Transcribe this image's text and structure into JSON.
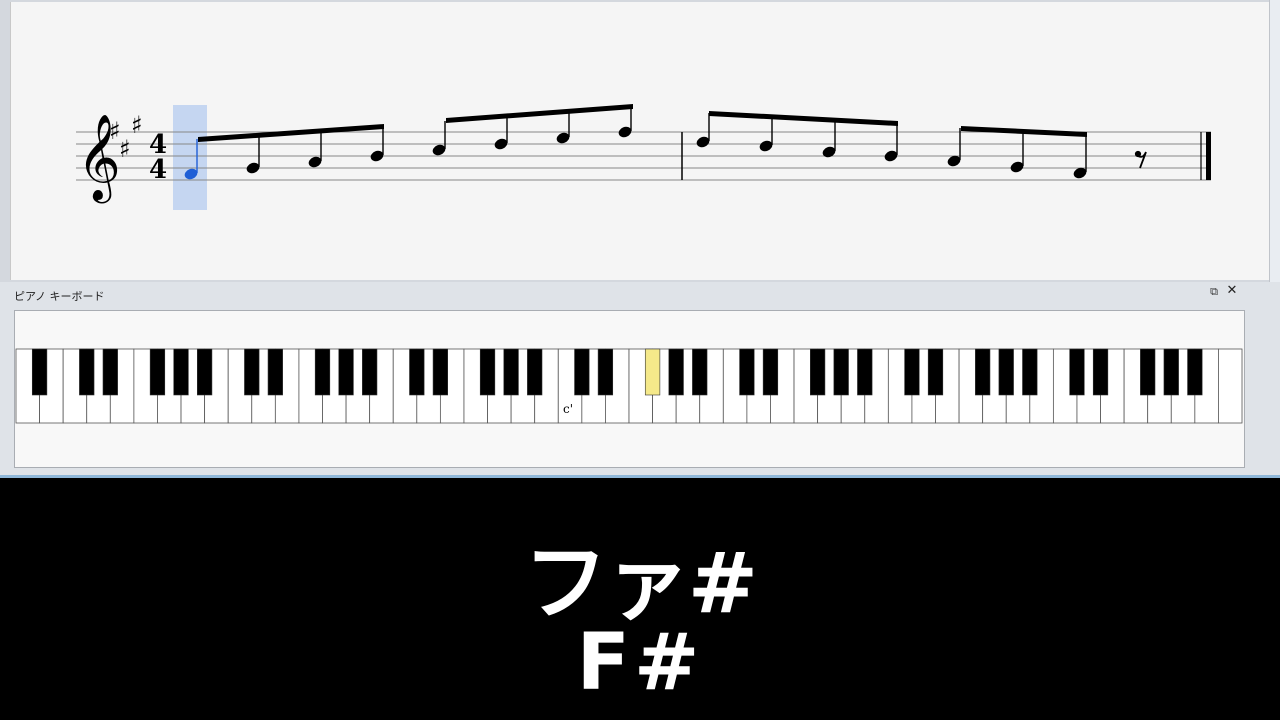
{
  "score": {
    "key_signature": "A major (3 sharps)",
    "time_signature": {
      "top": "4",
      "bottom": "4"
    },
    "selected_note_index": 0,
    "selection_color": "#c5d6f1",
    "selected_note_color": "#1f5fd6"
  },
  "keyboard": {
    "panel_title": "ピアノ キーボード",
    "undock_icon": "⧉",
    "close_icon": "✕",
    "middle_c_label": "c'",
    "highlighted_key": "F#",
    "highlight_color": "#f5e98a"
  },
  "display": {
    "note_japanese": "ファ#",
    "note_english": "F#"
  }
}
